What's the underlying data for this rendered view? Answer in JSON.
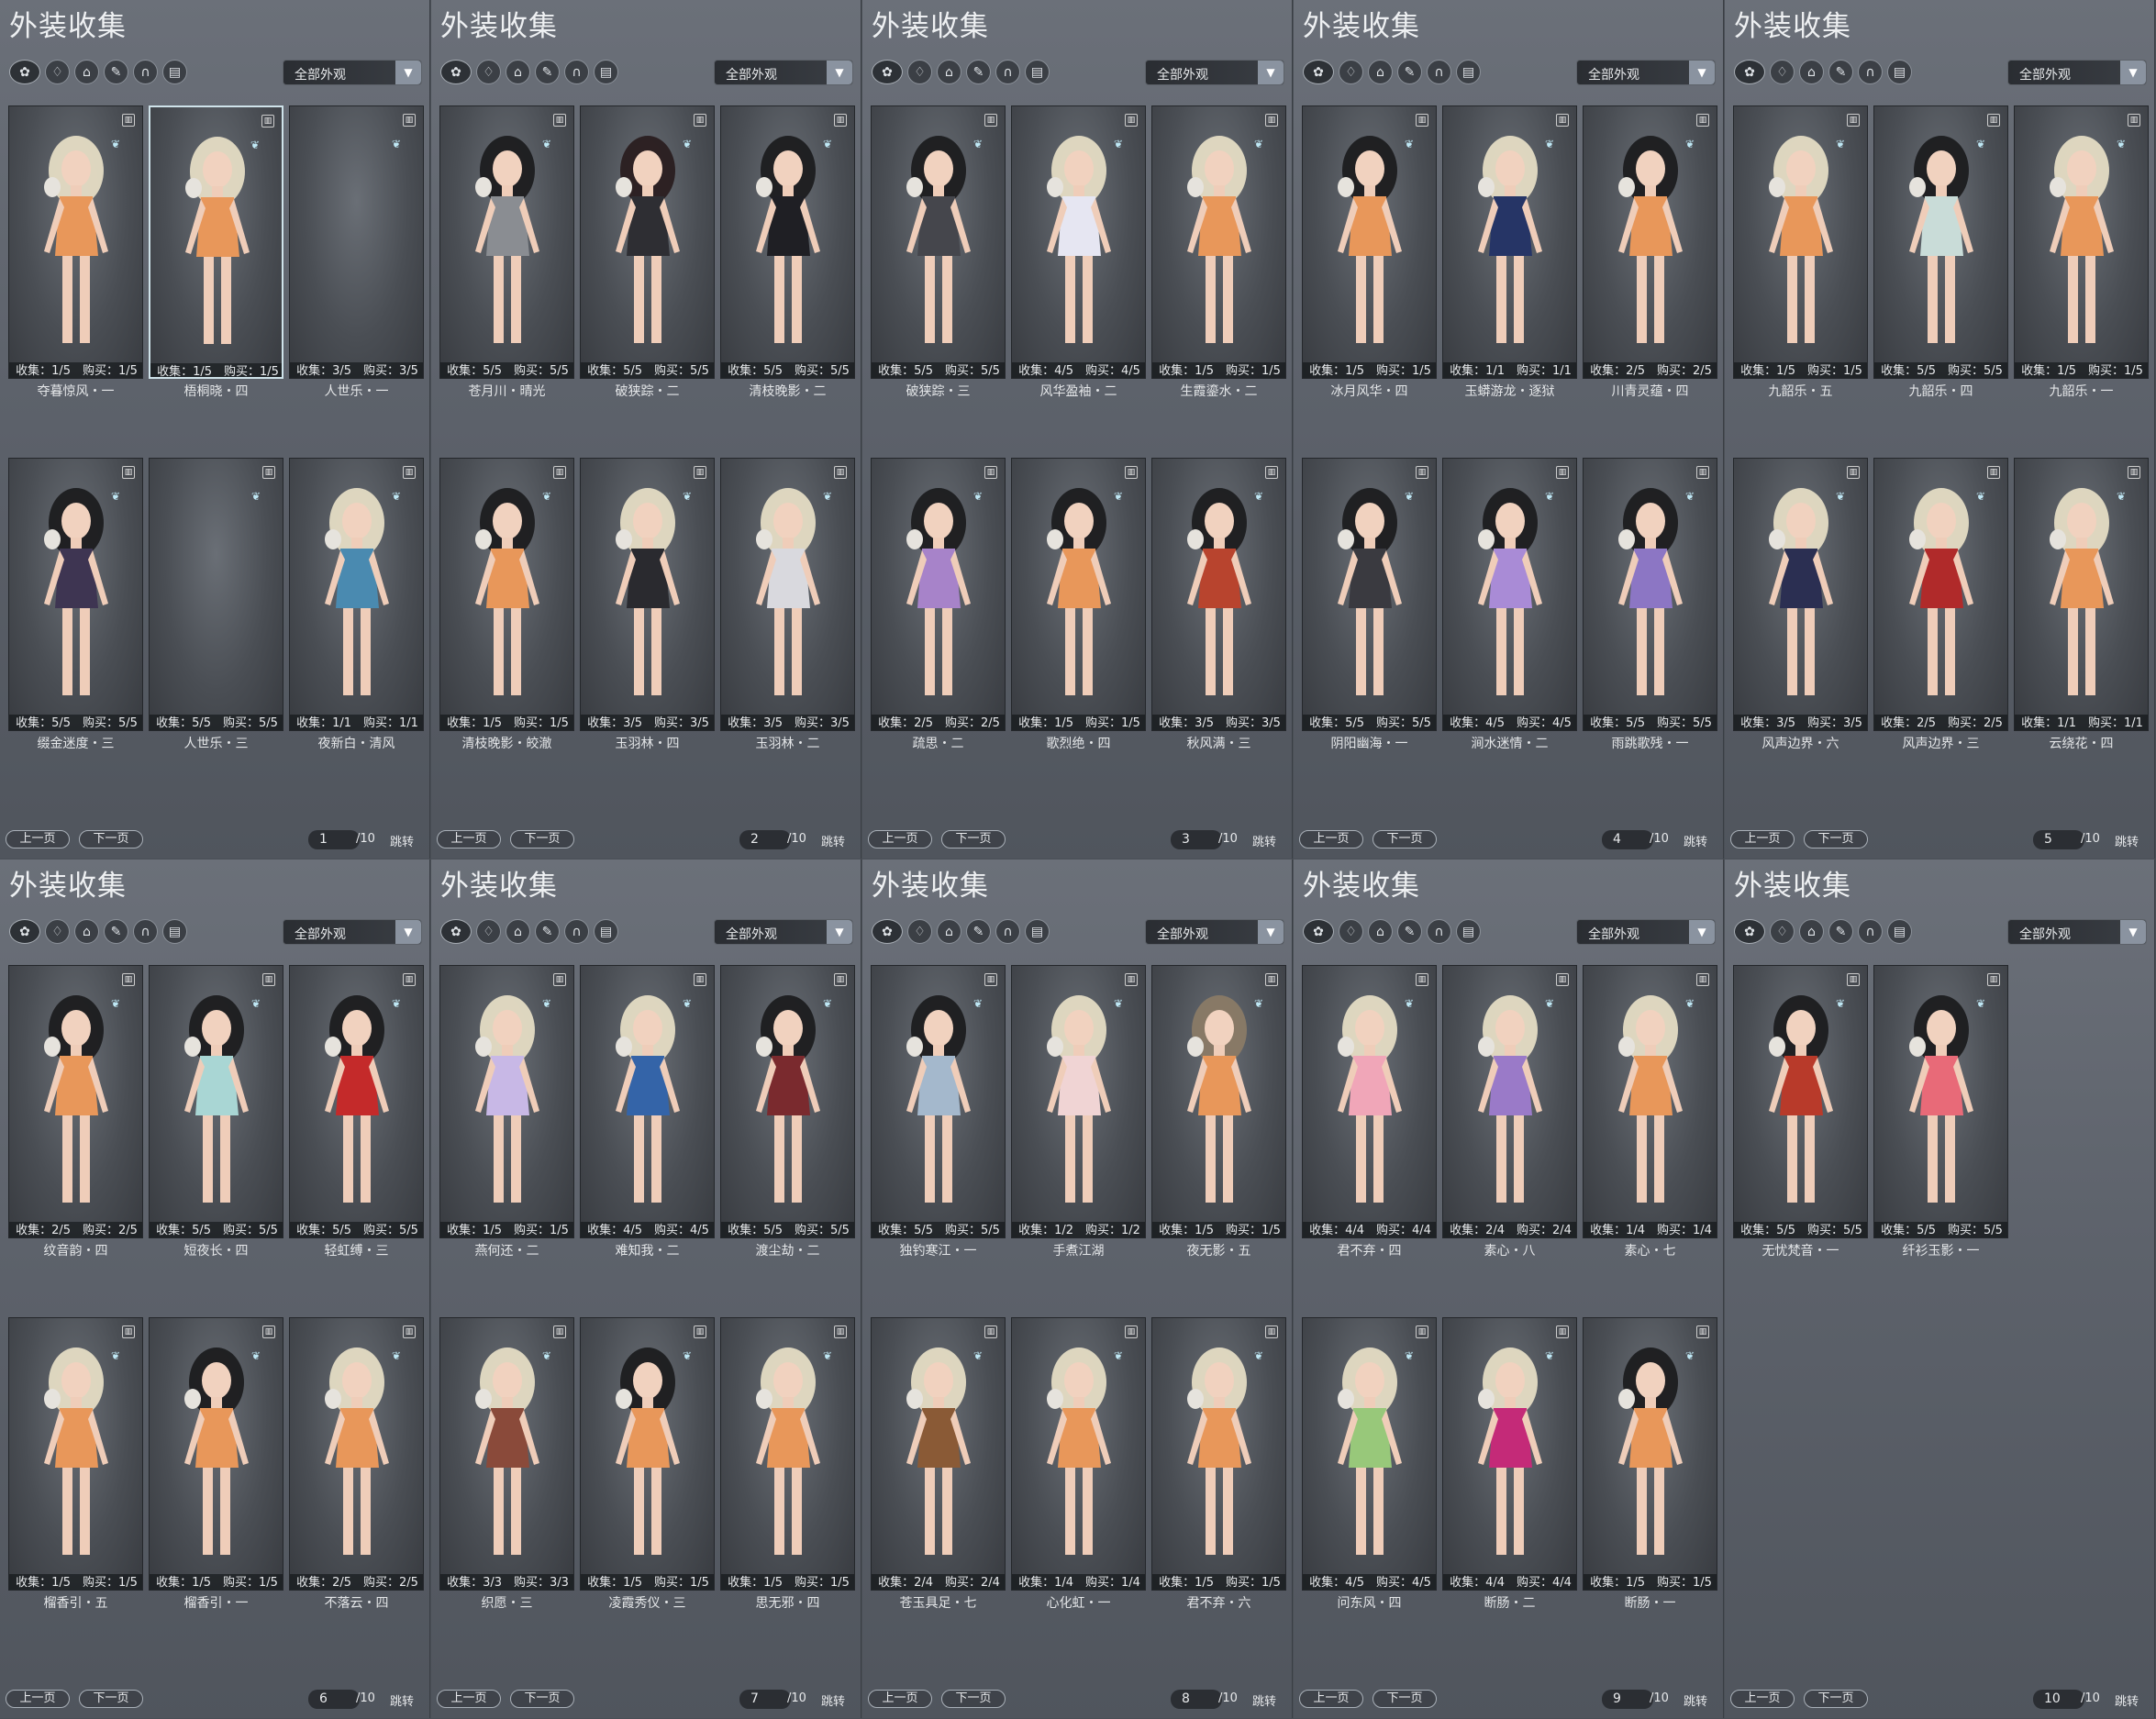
{
  "panel_title": "外装收集",
  "filter_value": "全部外观",
  "prev_label": "上一页",
  "next_label": "下一页",
  "jump_label": "跳转",
  "total_pages": "/10",
  "category_icons": [
    "all-outfits-icon",
    "top-icon",
    "pants-icon",
    "feather-icon",
    "shoes-icon",
    "scroll-icon"
  ],
  "colors": {
    "dress_orange": "#e8975a",
    "panel_bg": "#5d626b",
    "accent_arrow": "#8a93a0"
  },
  "panels": [
    {
      "page": "1",
      "items": [
        {
          "stats": "收集：1/5　购买：1/5",
          "name": "夺暮惊风・一",
          "outfit": "#e8975a",
          "hair": "#e5dcc4",
          "sel": false
        },
        {
          "stats": "收集：1/5　购买：1/5",
          "name": "梧桐晓・四",
          "outfit": "#e8975a",
          "hair": "#e5dcc4",
          "sel": true
        },
        {
          "stats": "收集：3/5　购买：3/5",
          "name": "人世乐・一",
          "outfit": "",
          "hair": "",
          "sel": false
        },
        {
          "stats": "收集：5/5　购买：5/5",
          "name": "缀金迷度・三",
          "outfit": "#3e3552",
          "hair": "#1c1c1f",
          "sel": false
        },
        {
          "stats": "收集：5/5　购买：5/5",
          "name": "人世乐・三",
          "outfit": "",
          "hair": "",
          "sel": false
        },
        {
          "stats": "收集：1/1　购买：1/1",
          "name": "夜新白・清风",
          "outfit": "#4a8ab0",
          "hair": "#e5dcc4",
          "sel": false
        }
      ]
    },
    {
      "page": "2",
      "items": [
        {
          "stats": "收集：5/5　购买：5/5",
          "name": "苍月川・晴光",
          "outfit": "#8a8d92",
          "hair": "#1c1c1f",
          "sel": false
        },
        {
          "stats": "收集：5/5　购买：5/5",
          "name": "破狭踪・二",
          "outfit": "#2e2e33",
          "hair": "#2a1e20",
          "sel": false
        },
        {
          "stats": "收集：5/5　购买：5/5",
          "name": "清枝晚影・二",
          "outfit": "#1f1f24",
          "hair": "#1c1c1f",
          "sel": false
        },
        {
          "stats": "收集：1/5　购买：1/5",
          "name": "清枝晚影・皎澈",
          "outfit": "#e8975a",
          "hair": "#1c1c1f",
          "sel": false
        },
        {
          "stats": "收集：3/5　购买：3/5",
          "name": "玉羽林・四",
          "outfit": "#2a2a2f",
          "hair": "#e5dcc4",
          "sel": false
        },
        {
          "stats": "收集：3/5　购买：3/5",
          "name": "玉羽林・二",
          "outfit": "#d9d9de",
          "hair": "#e5dcc4",
          "sel": false
        }
      ]
    },
    {
      "page": "3",
      "items": [
        {
          "stats": "收集：5/5　购买：5/5",
          "name": "破狭踪・三",
          "outfit": "#45464c",
          "hair": "#1c1c1f",
          "sel": false
        },
        {
          "stats": "收集：4/5　购买：4/5",
          "name": "风华盈袖・二",
          "outfit": "#e6e6f2",
          "hair": "#e5dcc4",
          "sel": false
        },
        {
          "stats": "收集：1/5　购买：1/5",
          "name": "生霞鎏水・二",
          "outfit": "#e8975a",
          "hair": "#e5dcc4",
          "sel": false
        },
        {
          "stats": "收集：2/5　购买：2/5",
          "name": "疏思・二",
          "outfit": "#a783c9",
          "hair": "#1c1c1f",
          "sel": false
        },
        {
          "stats": "收集：1/5　购买：1/5",
          "name": "歌烈绝・四",
          "outfit": "#e8975a",
          "hair": "#1c1c1f",
          "sel": false
        },
        {
          "stats": "收集：3/5　购买：3/5",
          "name": "秋风满・三",
          "outfit": "#b8442e",
          "hair": "#1c1c1f",
          "sel": false
        }
      ]
    },
    {
      "page": "4",
      "items": [
        {
          "stats": "收集：1/5　购买：1/5",
          "name": "冰月风华・四",
          "outfit": "#e8975a",
          "hair": "#1c1c1f",
          "sel": false
        },
        {
          "stats": "收集：1/1　购买：1/1",
          "name": "玉蟒游龙・逐狱",
          "outfit": "#263566",
          "hair": "#e5dcc4",
          "sel": false
        },
        {
          "stats": "收集：2/5　购买：2/5",
          "name": "川青灵蕴・四",
          "outfit": "#e8975a",
          "hair": "#1c1c1f",
          "sel": false
        },
        {
          "stats": "收集：5/5　购买：5/5",
          "name": "阴阳幽海・一",
          "outfit": "#3a3a40",
          "hair": "#1c1c1f",
          "sel": false
        },
        {
          "stats": "收集：4/5　购买：4/5",
          "name": "涧水迷情・二",
          "outfit": "#a98bd6",
          "hair": "#1c1c1f",
          "sel": false
        },
        {
          "stats": "收集：5/5　购买：5/5",
          "name": "雨跳歌残・一",
          "outfit": "#8c76c4",
          "hair": "#1c1c1f",
          "sel": false
        }
      ]
    },
    {
      "page": "5",
      "items": [
        {
          "stats": "收集：1/5　购买：1/5",
          "name": "九韶乐・五",
          "outfit": "#e8975a",
          "hair": "#e5dcc4",
          "sel": false
        },
        {
          "stats": "收集：5/5　购买：5/5",
          "name": "九韶乐・四",
          "outfit": "#c9dcd8",
          "hair": "#1c1c1f",
          "sel": false
        },
        {
          "stats": "收集：1/5　购买：1/5",
          "name": "九韶乐・一",
          "outfit": "#e8975a",
          "hair": "#e5dcc4",
          "sel": false
        },
        {
          "stats": "收集：3/5　购买：3/5",
          "name": "风声边界・六",
          "outfit": "#2b2f52",
          "hair": "#e5dcc4",
          "sel": false
        },
        {
          "stats": "收集：2/5　购买：2/5",
          "name": "风声边界・三",
          "outfit": "#b02a2a",
          "hair": "#e5dcc4",
          "sel": false
        },
        {
          "stats": "收集：1/1　购买：1/1",
          "name": "云绕花・四",
          "outfit": "#e8975a",
          "hair": "#e5dcc4",
          "sel": false
        }
      ]
    },
    {
      "page": "6",
      "items": [
        {
          "stats": "收集：2/5　购买：2/5",
          "name": "纹音韵・四",
          "outfit": "#e8975a",
          "hair": "#1c1c1f",
          "sel": false
        },
        {
          "stats": "收集：5/5　购买：5/5",
          "name": "短夜长・四",
          "outfit": "#a9d6d4",
          "hair": "#1c1c1f",
          "sel": false
        },
        {
          "stats": "收集：5/5　购买：5/5",
          "name": "轻虹缚・三",
          "outfit": "#c42a2a",
          "hair": "#1c1c1f",
          "sel": false
        },
        {
          "stats": "收集：1/5　购买：1/5",
          "name": "榴香引・五",
          "outfit": "#e8975a",
          "hair": "#e5dcc4",
          "sel": false
        },
        {
          "stats": "收集：1/5　购买：1/5",
          "name": "榴香引・一",
          "outfit": "#e8975a",
          "hair": "#1c1c1f",
          "sel": false
        },
        {
          "stats": "收集：2/5　购买：2/5",
          "name": "不落云・四",
          "outfit": "#e8975a",
          "hair": "#e5dcc4",
          "sel": false
        }
      ]
    },
    {
      "page": "7",
      "items": [
        {
          "stats": "收集：1/5　购买：1/5",
          "name": "燕何还・二",
          "outfit": "#c8b8e6",
          "hair": "#e5dcc4",
          "sel": false
        },
        {
          "stats": "收集：4/5　购买：4/5",
          "name": "难知我・二",
          "outfit": "#3464a8",
          "hair": "#e5dcc4",
          "sel": false
        },
        {
          "stats": "收集：5/5　购买：5/5",
          "name": "渡尘劫・二",
          "outfit": "#7a2a2e",
          "hair": "#1c1c1f",
          "sel": false
        },
        {
          "stats": "收集：3/3　购买：3/3",
          "name": "织愿・三",
          "outfit": "#8a4a3a",
          "hair": "#e5dcc4",
          "sel": false
        },
        {
          "stats": "收集：1/5　购买：1/5",
          "name": "凌霞秀仪・三",
          "outfit": "#e8975a",
          "hair": "#1c1c1f",
          "sel": false
        },
        {
          "stats": "收集：1/5　购买：1/5",
          "name": "思无邪・四",
          "outfit": "#e8975a",
          "hair": "#e5dcc4",
          "sel": false
        }
      ]
    },
    {
      "page": "8",
      "items": [
        {
          "stats": "收集：5/5　购买：5/5",
          "name": "独钓寒江・一",
          "outfit": "#a4b8cc",
          "hair": "#1c1c1f",
          "sel": false
        },
        {
          "stats": "收集：1/2　购买：1/2",
          "name": "手煮江湖",
          "outfit": "#f0d4d4",
          "hair": "#e5dcc4",
          "sel": false
        },
        {
          "stats": "收集：1/5　购买：1/5",
          "name": "夜无影・五",
          "outfit": "#e8975a",
          "hair": "#8a7a66",
          "sel": false
        },
        {
          "stats": "收集：2/4　购买：2/4",
          "name": "苍玉具足・七",
          "outfit": "#8a5a36",
          "hair": "#e5dcc4",
          "sel": false
        },
        {
          "stats": "收集：1/4　购买：1/4",
          "name": "心化虹・一",
          "outfit": "#e8975a",
          "hair": "#e5dcc4",
          "sel": false
        },
        {
          "stats": "收集：1/5　购买：1/5",
          "name": "君不弃・六",
          "outfit": "#e8975a",
          "hair": "#e5dcc4",
          "sel": false
        }
      ]
    },
    {
      "page": "9",
      "items": [
        {
          "stats": "收集：4/4　购买：4/4",
          "name": "君不弃・四",
          "outfit": "#f0a6b8",
          "hair": "#e5dcc4",
          "sel": false
        },
        {
          "stats": "收集：2/4　购买：2/4",
          "name": "素心・八",
          "outfit": "#9a7ac8",
          "hair": "#e5dcc4",
          "sel": false
        },
        {
          "stats": "收集：1/4　购买：1/4",
          "name": "素心・七",
          "outfit": "#e8975a",
          "hair": "#e5dcc4",
          "sel": false
        },
        {
          "stats": "收集：4/5　购买：4/5",
          "name": "问东风・四",
          "outfit": "#98c87a",
          "hair": "#e5dcc4",
          "sel": false
        },
        {
          "stats": "收集：4/4　购买：4/4",
          "name": "断肠・二",
          "outfit": "#c42a78",
          "hair": "#e5dcc4",
          "sel": false
        },
        {
          "stats": "收集：1/5　购买：1/5",
          "name": "断肠・一",
          "outfit": "#e8975a",
          "hair": "#1c1c1f",
          "sel": false
        }
      ]
    },
    {
      "page": "10",
      "items": [
        {
          "stats": "收集：5/5　购买：5/5",
          "name": "无忧梵音・一",
          "outfit": "#b83a2a",
          "hair": "#1c1c1f",
          "sel": false
        },
        {
          "stats": "收集：5/5　购买：5/5",
          "name": "纤衫玉影・一",
          "outfit": "#e86a78",
          "hair": "#1c1c1f",
          "sel": false
        }
      ]
    }
  ]
}
